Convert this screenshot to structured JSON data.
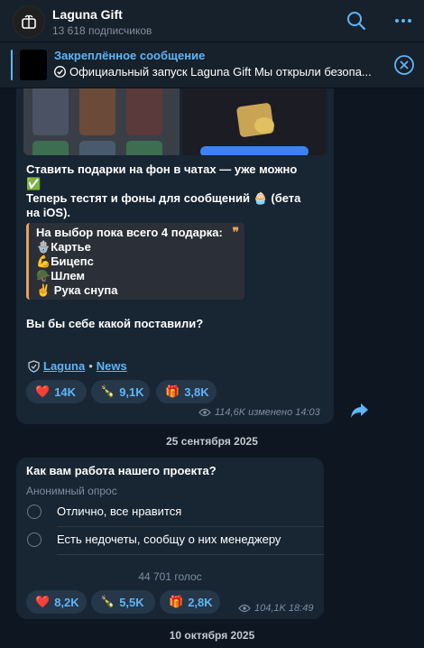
{
  "channel": {
    "title": "Laguna Gift",
    "subscribers": "13 618 подписчиков"
  },
  "pinned": {
    "title": "Закреплённое сообщение",
    "text": "Официальный запуск Laguna Gift  Мы открыли безопа..."
  },
  "post1": {
    "line1": "Ставить подарки на фон в чатах — уже можно",
    "line2": "Теперь тестят и фоны для сообщений",
    "line2b": "(бета",
    "line3": "на iOS).",
    "quote": {
      "title": "На выбор пока всего 4 подарка:",
      "items": [
        "Картье",
        "Бицепс",
        "Шлем",
        " Рука снупа"
      ]
    },
    "question": "Вы бы себе какой поставили?",
    "link1": "Laguna",
    "separator": "•",
    "link2": "News",
    "reactions": [
      {
        "emoji": "❤️",
        "count": "14K"
      },
      {
        "emoji": "🍾",
        "count": "9,1K"
      },
      {
        "emoji": "🎁",
        "count": "3,8K"
      }
    ],
    "meta": "114,6K изменено 14:03"
  },
  "date1": "25 сентября 2025",
  "poll": {
    "question": "Как вам работа нашего проекта?",
    "type": "Анонимный опрос",
    "options": [
      "Отлично, все нравится",
      "Есть недочеты, сообщу о них менеджеру"
    ],
    "votes": "44 701 голос",
    "reactions": [
      {
        "emoji": "❤️",
        "count": "8,2K"
      },
      {
        "emoji": "🍾",
        "count": "5,5K"
      },
      {
        "emoji": "🎁",
        "count": "2,8K"
      }
    ],
    "meta": "104,1K 18:49"
  },
  "date2": "10 октября 2025",
  "colors": {
    "accent": "#5eb5f7",
    "background": "#0e1621",
    "bubble": "#182533"
  }
}
